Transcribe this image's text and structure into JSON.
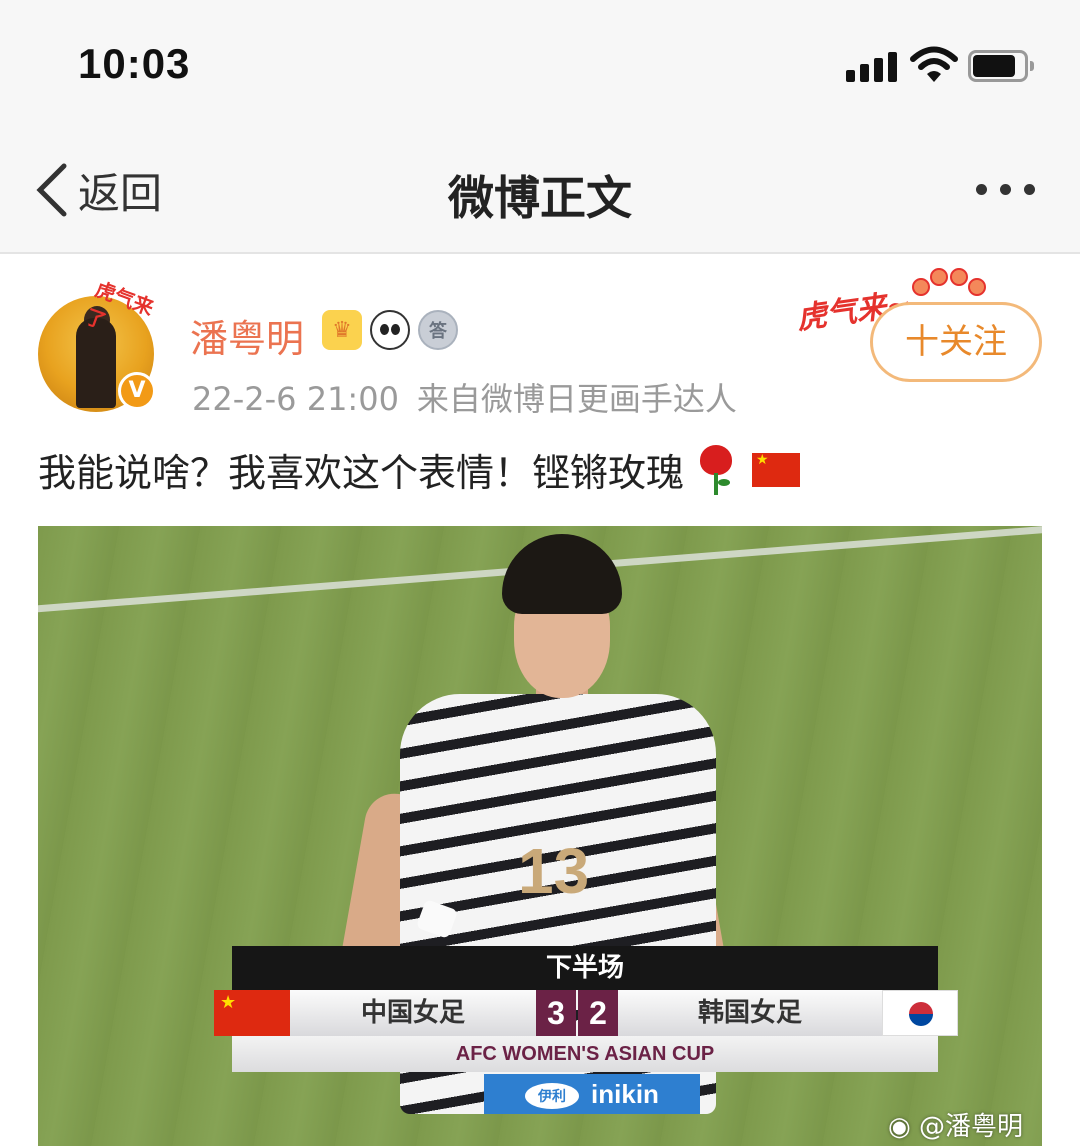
{
  "status_bar": {
    "time": "10:03"
  },
  "nav": {
    "back_label": "返回",
    "title": "微博正文"
  },
  "post": {
    "author": "潘粤明",
    "time": "22-2-6 21:00",
    "source": "来自微博日更画手达人",
    "follow_label": "十关注",
    "text": "我能说啥？我喜欢这个表情！铿锵玫瑰",
    "badges": [
      "crown-icon",
      "panda-icon",
      "medal-icon"
    ],
    "verified_letter": "V",
    "avatar_tag": "虎气来了",
    "decoration_text": "虎气来~",
    "medal_char": "答",
    "emoji": [
      "rose-icon",
      "china-flag-icon"
    ]
  },
  "image": {
    "jersey_number": "13",
    "scoreboard": {
      "period": "下半场",
      "team_home": "中国女足",
      "score_home": "3",
      "score_away": "2",
      "team_away": "韩国女足",
      "competition": "AFC WOMEN'S ASIAN CUP"
    },
    "sponsor_logo": "伊利",
    "sponsor": "inikin",
    "watermark": "@潘粤明"
  },
  "colors": {
    "username": "#eb7350",
    "follow": "#e8892b",
    "score_bg": "#6b2246"
  }
}
